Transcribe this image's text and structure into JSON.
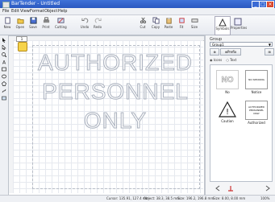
{
  "window": {
    "title": "BarTender - Untitled"
  },
  "menu": [
    "File",
    "Edit",
    "View",
    "Format",
    "Object",
    "Help"
  ],
  "toolbar": [
    {
      "label": "New",
      "icon": "new-doc-icon"
    },
    {
      "label": "Open",
      "icon": "open-folder-icon"
    },
    {
      "label": "Save",
      "icon": "save-icon"
    },
    {
      "label": "Print",
      "icon": "print-icon"
    },
    {
      "label": "Cutting",
      "icon": "cutting-icon"
    },
    {
      "label": "Undo",
      "icon": "undo-icon"
    },
    {
      "label": "Redo",
      "icon": "redo-icon"
    },
    {
      "label": "Cut",
      "icon": "cut-icon"
    },
    {
      "label": "Copy",
      "icon": "copy-icon"
    },
    {
      "label": "Paste",
      "icon": "paste-icon"
    },
    {
      "label": "Fit",
      "icon": "fit-icon"
    },
    {
      "label": "Size",
      "icon": "size-icon"
    }
  ],
  "right_tabs": [
    {
      "label": "Symbols",
      "icon": "symbols-icon"
    },
    {
      "label": "Properties",
      "icon": "properties-icon"
    }
  ],
  "canvas": {
    "tab_label": "1",
    "lines": [
      "AUTHORIZED",
      "PERSONNEL",
      "ONLY"
    ]
  },
  "panel": {
    "group_label": "Group",
    "group_value": "Group1",
    "btn_left": "⊕",
    "btn_mid": "⊕Prefix",
    "btn_right": "⊞",
    "radio_icons": "Icons",
    "radio_list": "Text",
    "symbols": [
      {
        "name": "No",
        "thumb": "NO"
      },
      {
        "name": "Notice",
        "thumb": "NO SMOKING"
      },
      {
        "name": "Caution",
        "thumb": "!"
      },
      {
        "name": "Authorized",
        "thumb": "AUTHORIZED PERSONNEL ONLY"
      }
    ]
  },
  "status": {
    "cursor": "Cursor: 135.91, 127.4 mm",
    "obj": "Object: 38.3, 38.5 mm",
    "size": "Size: 196.2, 196.8 mm",
    "zoom": "Size: 8.00, 8.00 mm",
    "percent": "100%"
  },
  "colors": {
    "titlebar": "#2a58c0",
    "text_outline": "#a9b0bd"
  }
}
